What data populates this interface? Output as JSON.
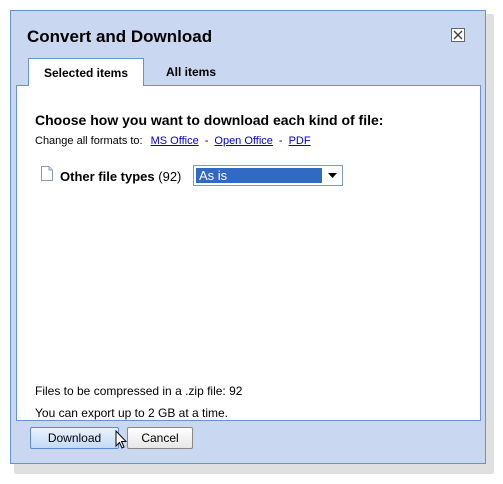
{
  "dialog": {
    "title": "Convert and Download"
  },
  "tabs": [
    {
      "label": "Selected items",
      "active": true
    },
    {
      "label": "All items",
      "active": false
    }
  ],
  "content": {
    "heading": "Choose how you want to download each kind of file:",
    "change_all_label": "Change all formats to:",
    "format_links": [
      "MS Office",
      "Open Office",
      "PDF"
    ],
    "separator": "-",
    "file_types": [
      {
        "name": "Other file types",
        "count": "(92)",
        "selected_option": "As is"
      }
    ],
    "compressed_info": "Files to be compressed in a .zip file: 92",
    "export_limit_info": "You can export up to 2 GB at a time."
  },
  "buttons": {
    "download": "Download",
    "cancel": "Cancel"
  },
  "icons": {
    "close": "close-icon",
    "document": "document-icon",
    "dropdown": "chevron-down-icon",
    "cursor": "mouse-pointer-icon"
  },
  "colors": {
    "dialog_bg": "#c9d7f1",
    "border": "#6b90da",
    "link": "#0000cc",
    "selection": "#316ac5"
  }
}
